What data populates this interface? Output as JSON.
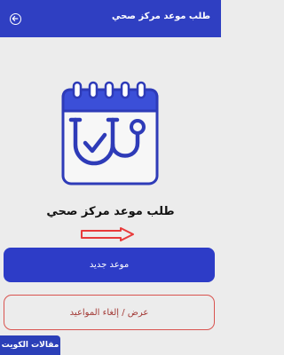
{
  "header": {
    "title": "طلب موعد مركز صحي",
    "back_icon": "arrow-left-circle-icon",
    "background": "#2f3fc2"
  },
  "hero": {
    "icon": "calendar-stethoscope-icon",
    "heading": "طلب موعد مركز صحي"
  },
  "annotation": {
    "icon": "down-arrow-outline-icon",
    "color": "#e83a3a"
  },
  "actions": {
    "new_appointment": "موعد جديد",
    "view_cancel": "عرض / إلغاء المواعيد"
  },
  "watermark": {
    "text": "مقالات الكويت"
  },
  "colors": {
    "primary": "#2d3cc7",
    "danger_outline": "#d9534f",
    "background": "#ececec"
  }
}
